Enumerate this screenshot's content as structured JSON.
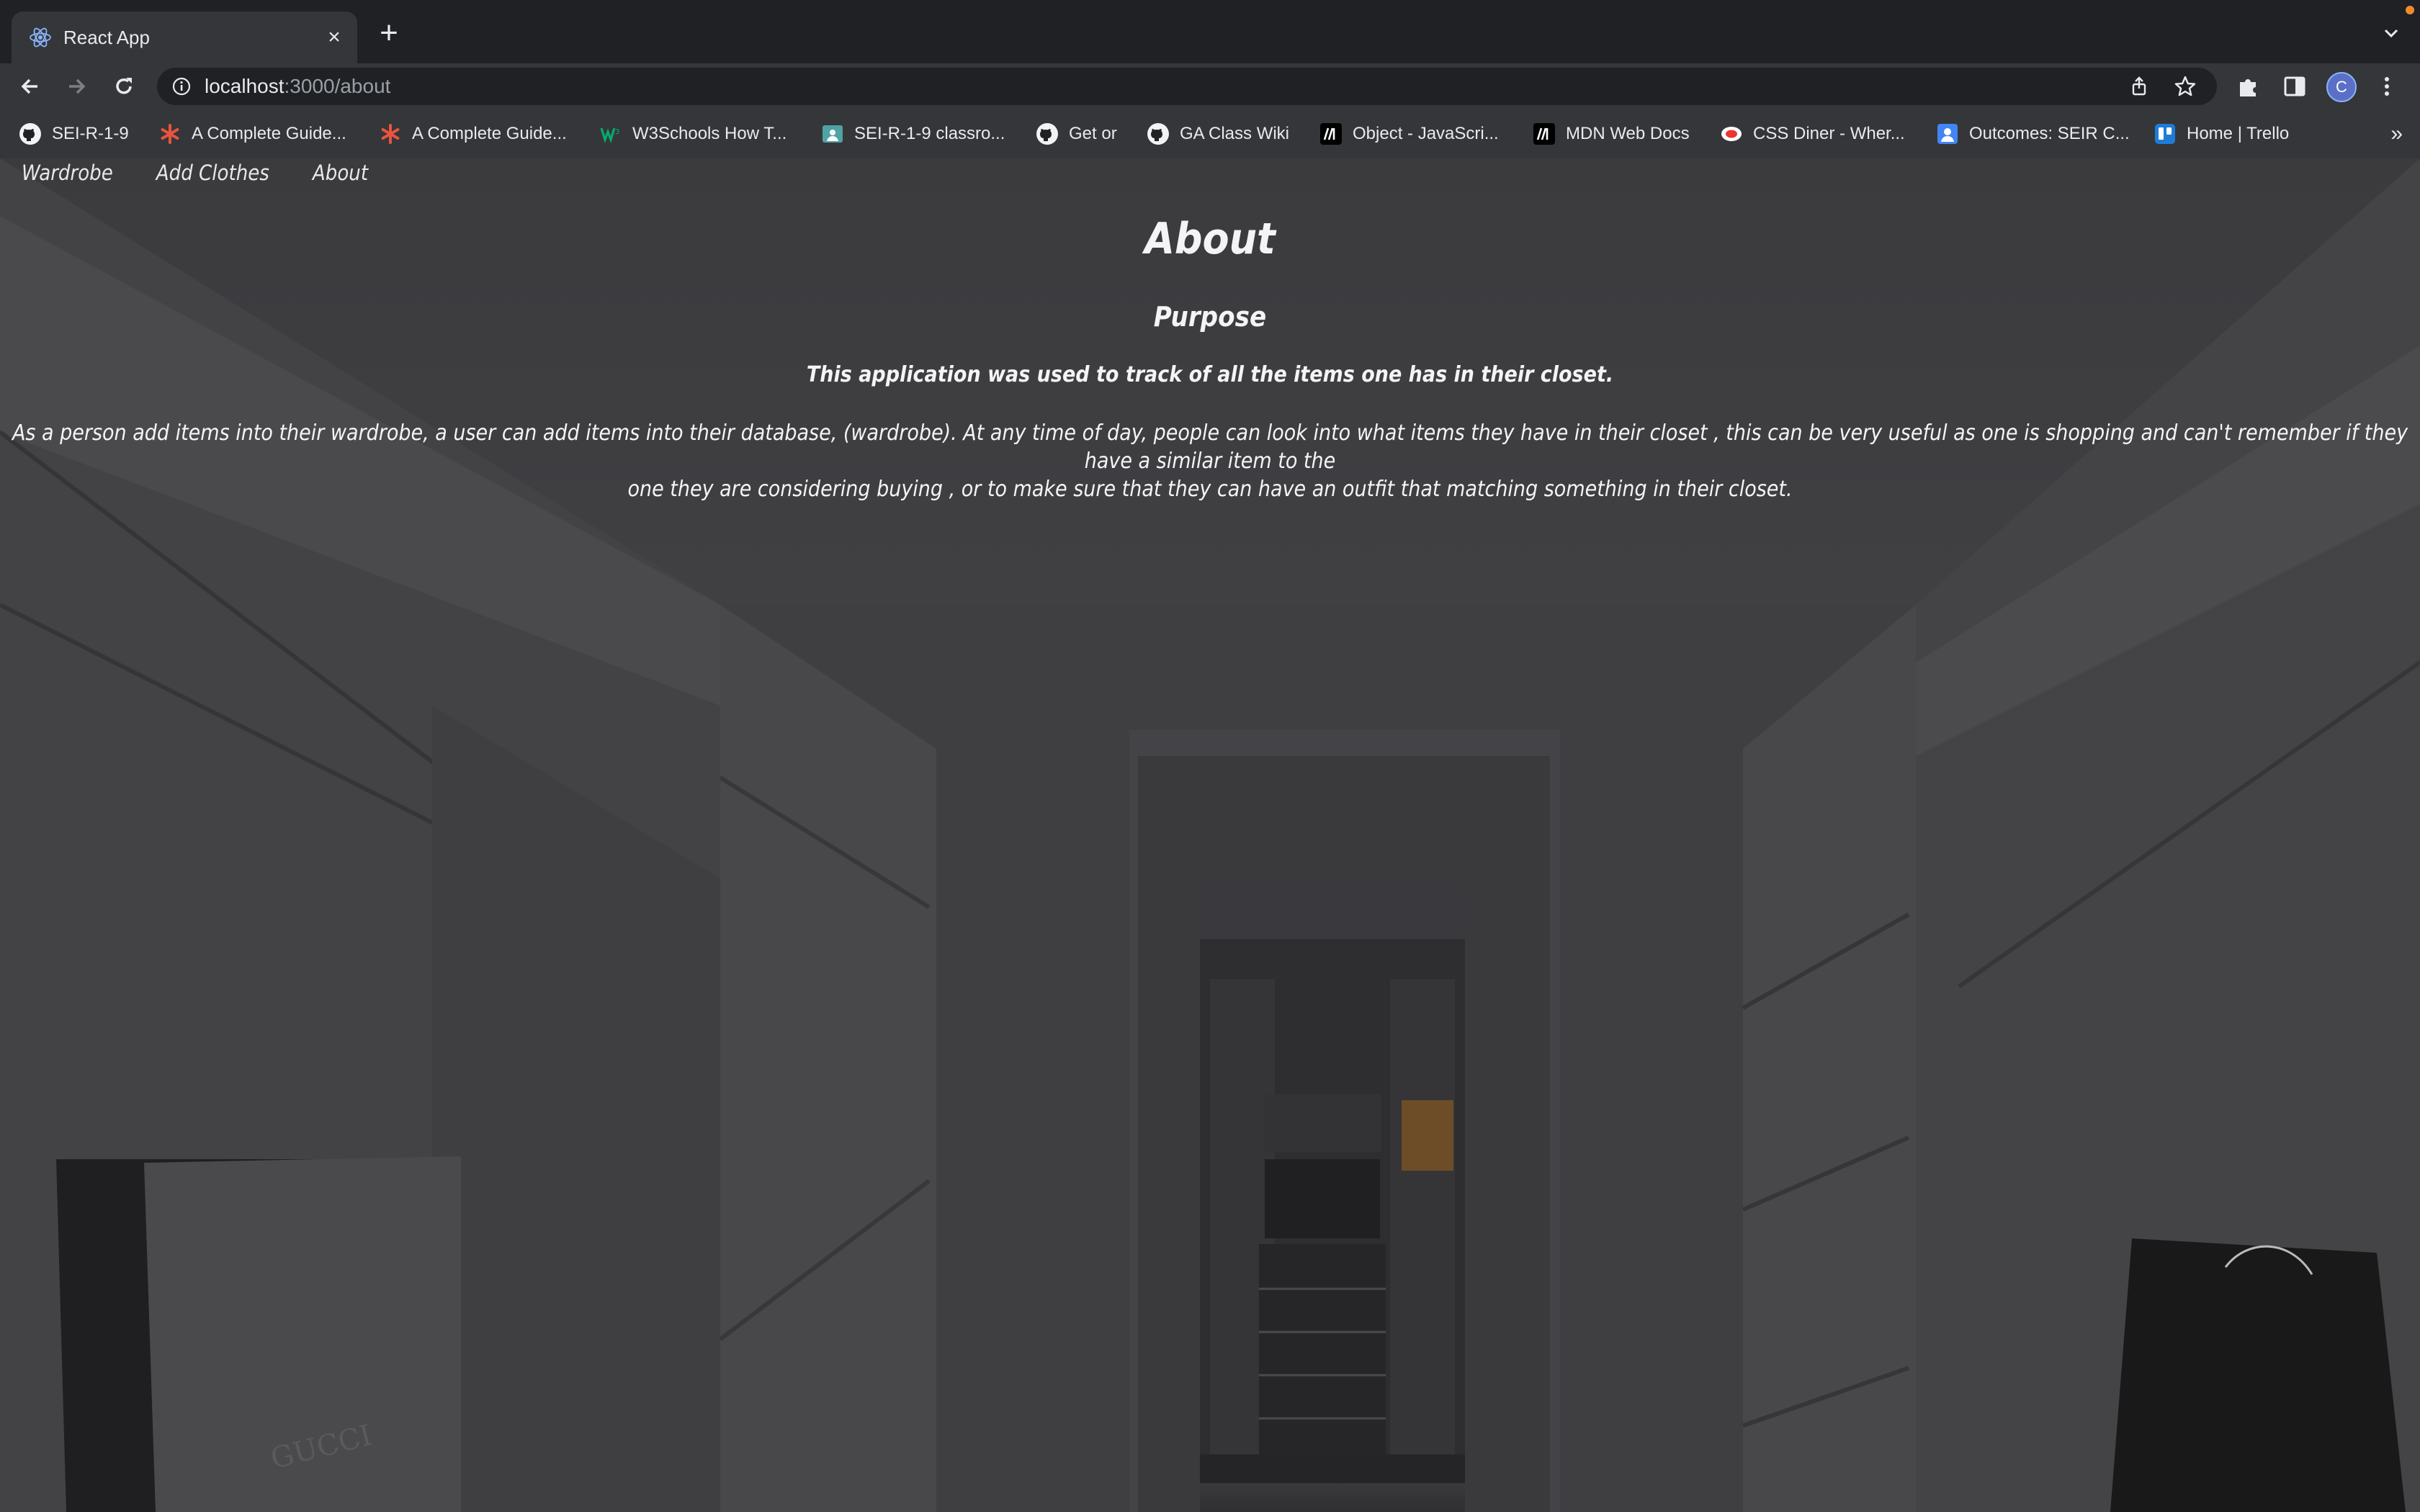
{
  "browser": {
    "tab_title": "React App",
    "url_host": "localhost",
    "url_path": ":3000/about",
    "profile_initial": "C",
    "bookmarks": [
      {
        "label": "SEI-R-1-9",
        "icon": "github-icon"
      },
      {
        "label": "A Complete Guide...",
        "icon": "asterisk-icon"
      },
      {
        "label": "A Complete Guide...",
        "icon": "asterisk-icon"
      },
      {
        "label": "W3Schools How T...",
        "icon": "w3schools-icon"
      },
      {
        "label": "SEI-R-1-9 classro...",
        "icon": "classroom-icon"
      },
      {
        "label": "Get or",
        "icon": "github-icon"
      },
      {
        "label": "GA Class Wiki",
        "icon": "github-icon"
      },
      {
        "label": "Object - JavaScri...",
        "icon": "mdn-icon"
      },
      {
        "label": "MDN Web Docs",
        "icon": "mdn-icon"
      },
      {
        "label": "CSS Diner - Wher...",
        "icon": "css-diner-icon"
      },
      {
        "label": "Outcomes: SEIR C...",
        "icon": "outcomes-icon"
      },
      {
        "label": "Home | Trello",
        "icon": "trello-icon"
      }
    ],
    "bookmarks_more": "»"
  },
  "site_nav": {
    "links": [
      "Wardrobe",
      "Add Clothes",
      "About"
    ]
  },
  "about": {
    "title": "About",
    "subtitle": "Purpose",
    "lead": "This application was used to track of all the items one has in their closet.",
    "body_line1": "As a person add items into their wardrobe, a user can add items into their database, (wardrobe). At any time of day, people can look into what items they have in their closet , this can be very useful as one is shopping and can't remember if they have a similar item to the",
    "body_line2": "one they are considering buying , or to make sure that they can have an outfit that matching something in their closet."
  },
  "background_image": {
    "stamp_text": "GUCCI"
  },
  "colors": {
    "chrome_dark": "#202124",
    "chrome_mid": "#35363a",
    "profile": "#5b6fc7",
    "overlay_text": "#f4f4f6"
  }
}
